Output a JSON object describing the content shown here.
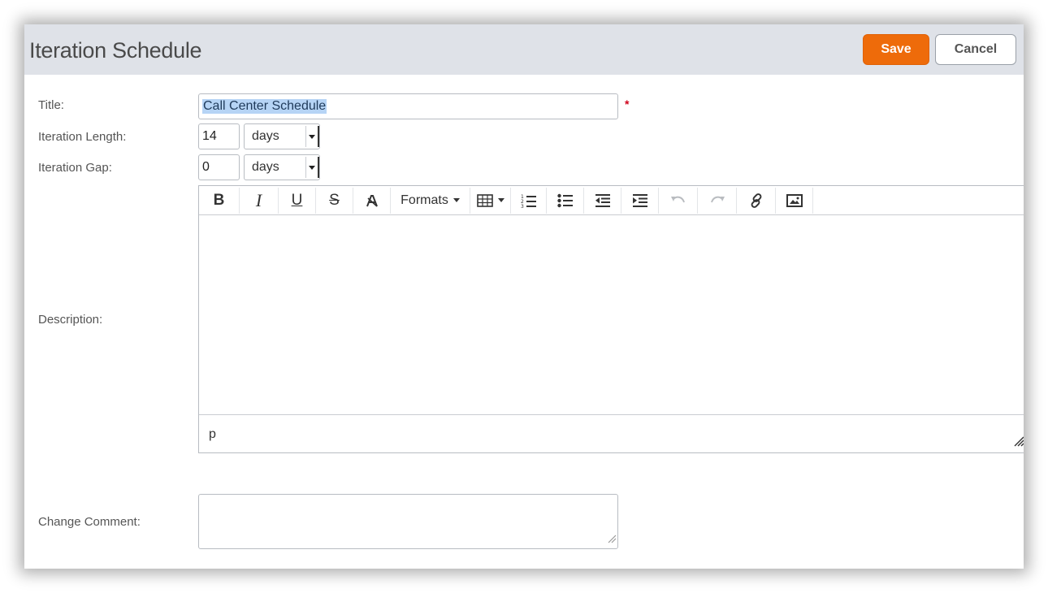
{
  "header": {
    "title": "Iteration Schedule",
    "save_label": "Save",
    "cancel_label": "Cancel"
  },
  "form": {
    "title_label": "Title:",
    "title_value": "Call Center Schedule",
    "required_mark": "*",
    "iteration_length_label": "Iteration Length:",
    "iteration_length_value": "14",
    "iteration_length_unit": "days",
    "iteration_gap_label": "Iteration Gap:",
    "iteration_gap_value": "0",
    "iteration_gap_unit": "days",
    "description_label": "Description:",
    "change_comment_label": "Change Comment:"
  },
  "editor": {
    "formats_label": "Formats",
    "status_path": "p",
    "toolbar_icons": [
      "bold-icon",
      "italic-icon",
      "underline-icon",
      "strikethrough-icon",
      "clear-formatting-icon",
      "formats-dropdown",
      "table-icon",
      "numbered-list-icon",
      "bullet-list-icon",
      "outdent-icon",
      "indent-icon",
      "undo-icon",
      "redo-icon",
      "link-icon",
      "image-icon"
    ]
  },
  "colors": {
    "accent": "#ee6b0a",
    "header_bg": "#dfe2e8",
    "required": "#d0021b",
    "selection": "#b6d4f5"
  }
}
